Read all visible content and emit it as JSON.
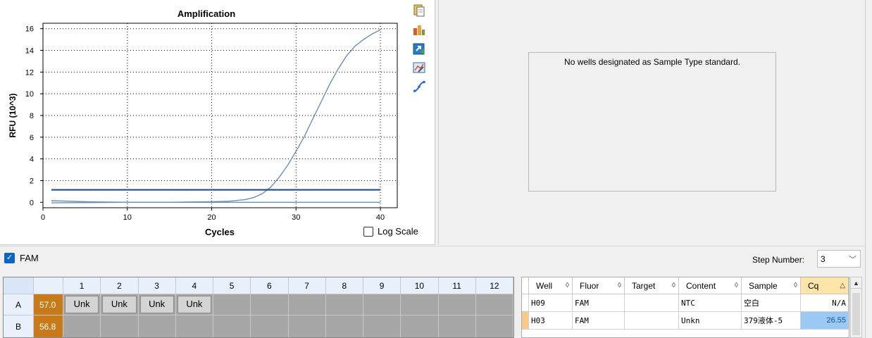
{
  "chart": {
    "title": "Amplification",
    "ylabel": "RFU (10^3)",
    "xlabel": "Cycles",
    "log_scale_label": "Log Scale"
  },
  "chart_data": {
    "type": "line",
    "title": "Amplification",
    "xlabel": "Cycles",
    "ylabel": "RFU (10^3)",
    "xlim": [
      0,
      42
    ],
    "ylim": [
      -0.5,
      16.5
    ],
    "x_ticks": [
      0,
      10,
      20,
      30,
      40
    ],
    "y_ticks": [
      0,
      2,
      4,
      6,
      8,
      10,
      12,
      14,
      16
    ],
    "grid": true,
    "series": [
      {
        "color": "#6b8fb5",
        "x": [
          1,
          5,
          10,
          15,
          20,
          22,
          24,
          25,
          26,
          27,
          28,
          29,
          30,
          31,
          32,
          33,
          34,
          35,
          36,
          37,
          38,
          39,
          40
        ],
        "y": [
          0.15,
          0.05,
          0.0,
          0.0,
          0.05,
          0.1,
          0.25,
          0.45,
          0.8,
          1.4,
          2.3,
          3.4,
          4.7,
          6.1,
          7.7,
          9.3,
          10.9,
          12.3,
          13.5,
          14.4,
          15.0,
          15.5,
          15.9
        ]
      },
      {
        "color": "#6b8fb5",
        "x": [
          1,
          10,
          20,
          30,
          40
        ],
        "y": [
          -0.05,
          0.0,
          0.0,
          0.0,
          0.0
        ]
      }
    ],
    "threshold": {
      "y": 1.15,
      "color": "#1f4e8c"
    }
  },
  "toolbar": {
    "icons": [
      "copy-icon",
      "chart-bar-icon",
      "export-icon",
      "chart-settings-icon",
      "curve-icon"
    ]
  },
  "standard_curve": {
    "message": "No wells designated as Sample Type standard."
  },
  "fluor": {
    "label": "FAM",
    "checked": true
  },
  "step": {
    "label": "Step Number:",
    "value": "3"
  },
  "plate": {
    "columns": [
      "1",
      "2",
      "3",
      "4",
      "5",
      "6",
      "7",
      "8",
      "9",
      "10",
      "11",
      "12"
    ],
    "rows": [
      {
        "label": "A",
        "temp": "57.0",
        "wells": [
          "Unk",
          "Unk",
          "Unk",
          "Unk",
          "",
          "",
          "",
          "",
          "",
          "",
          "",
          ""
        ]
      },
      {
        "label": "B",
        "temp": "56.8",
        "wells": [
          "",
          "",
          "",
          "",
          "",
          "",
          "",
          "",
          "",
          "",
          "",
          ""
        ]
      }
    ]
  },
  "results": {
    "headers": [
      "Well",
      "Fluor",
      "Target",
      "Content",
      "Sample",
      "Cq"
    ],
    "rows": [
      {
        "well": "H09",
        "fluor": "FAM",
        "target": "",
        "content": "NTC",
        "sample": "空白",
        "cq": "N/A"
      },
      {
        "well": "H03",
        "fluor": "FAM",
        "target": "",
        "content": "Unkn",
        "sample": "379液体-5",
        "cq": "26.55"
      }
    ]
  }
}
